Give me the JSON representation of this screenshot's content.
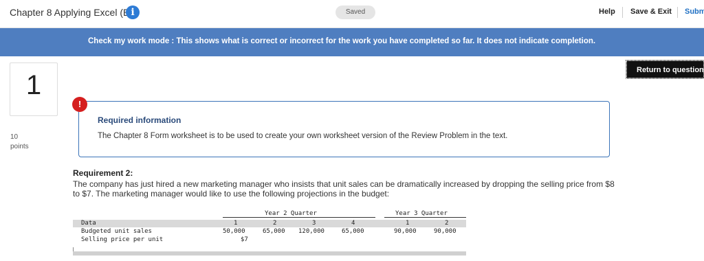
{
  "header": {
    "title": "Chapter 8 Applying Excel (B)",
    "info_icon": "i",
    "saved_status": "Saved",
    "help": "Help",
    "save_exit": "Save & Exit",
    "submit": "Subm"
  },
  "banner": {
    "text": "Check my work mode : This shows what is correct or incorrect for the work you have completed so far. It does not indicate completion."
  },
  "question": {
    "number": "1",
    "points_value": "10",
    "points_label": "points",
    "return_button": "Return to question"
  },
  "required_info": {
    "alert_icon": "!",
    "title": "Required information",
    "body": "The Chapter 8 Form worksheet is to be used to create your own worksheet version of the Review Problem in the text."
  },
  "requirement2": {
    "title": "Requirement 2:",
    "body": "The company has just hired a new marketing manager who insists that unit sales can be dramatically increased by dropping the selling price from $8 to $7. The marketing manager would like to use the following projections in the budget:"
  },
  "worksheet": {
    "group_year2": "Year 2 Quarter",
    "group_year3": "Year 3 Quarter",
    "header_row": {
      "label": "Data",
      "q1": "1",
      "q2": "2",
      "q3": "3",
      "q4": "4",
      "y3q1": "1",
      "y3q2": "2"
    },
    "rows": [
      {
        "label": "Budgeted unit sales",
        "q1": "50,000",
        "q2": "65,000",
        "q3": "120,000",
        "q4": "65,000",
        "y3q1": "90,000",
        "y3q2": "90,000"
      },
      {
        "label": "Selling price per unit",
        "q1": "$7",
        "q2": "",
        "q3": "",
        "q4": "",
        "y3q1": "",
        "y3q2": ""
      }
    ]
  }
}
